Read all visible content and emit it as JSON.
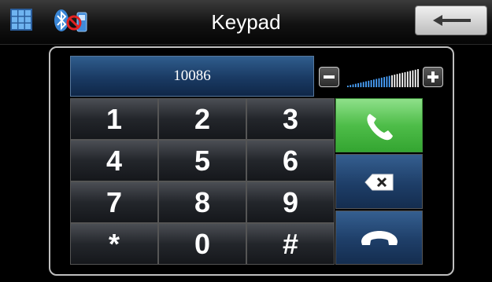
{
  "header": {
    "title": "Keypad",
    "icons": [
      "grid-menu-icon",
      "bluetooth-icon",
      "phone-disconnected-icon",
      "back-arrow-icon"
    ]
  },
  "display": {
    "number": "10086"
  },
  "volume": {
    "decrease_symbol": "−",
    "increase_symbol": "+",
    "level_fraction": 1.0
  },
  "keypad": {
    "keys": [
      "1",
      "2",
      "3",
      "4",
      "5",
      "6",
      "7",
      "8",
      "9",
      "*",
      "0",
      "#"
    ]
  },
  "actions": [
    "call-icon",
    "backspace-icon",
    "hang-up-icon"
  ],
  "colors": {
    "call_green": "#4ebd49",
    "display_blue": "#1a3a63",
    "action_blue": "#1e3e68"
  }
}
